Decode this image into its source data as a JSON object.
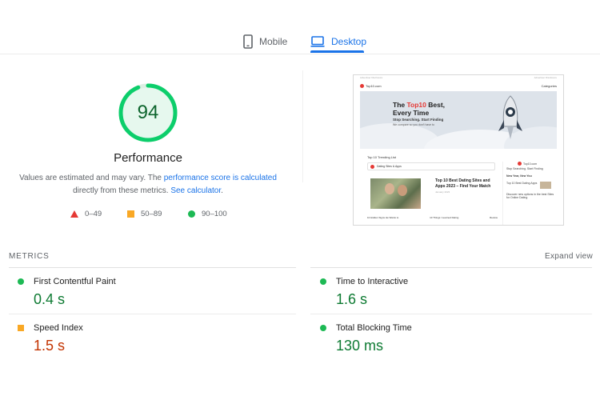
{
  "tabs": {
    "mobile_label": "Mobile",
    "desktop_label": "Desktop",
    "active": "desktop"
  },
  "score": {
    "value": "94",
    "fraction": 0.94,
    "title": "Performance",
    "desc_prefix": "Values are estimated and may vary. The ",
    "desc_link1": "performance score is calculated",
    "desc_middle": " directly from these metrics. ",
    "desc_link2": "See calculator",
    "desc_suffix": "."
  },
  "legend": {
    "fail": "0–49",
    "average": "50–89",
    "pass": "90–100"
  },
  "screenshot": {
    "top_left": "Advertiser Disclosure",
    "top_right": "Advertiser Disclosure",
    "logo": "Top10.com",
    "categories": "Categories",
    "hero_title_before": "The ",
    "hero_title_highlight": "Top10",
    "hero_title_after": " Best, Every Time",
    "hero_sub": "Stop Searching. Start Finding",
    "hero_sub2": "We compare so you don't have to",
    "trending": "Top 10 Trending List",
    "trending_select": "Dating Sites & Apps",
    "post_title": "Top 10 Best Dating Sites and Apps 2023 – Find Your Match",
    "post_meta": "January 2023",
    "bottom_left": "10 Hidden Signs He Wants to",
    "bottom_mid": "10 Things I Learned Dating",
    "bottom_right": "Review",
    "side_logo": "Top10.com",
    "side_tag": "Stop Searching. Start Finding",
    "side_h": "New Year, New You",
    "side_item": "Top 10 Best Dating Apps",
    "side_item2": "Discover new options in the best Sites for Online Dating"
  },
  "metrics": {
    "heading": "METRICS",
    "expand": "Expand view",
    "fcp_label": "First Contentful Paint",
    "fcp_value": "0.4 s",
    "tti_label": "Time to Interactive",
    "tti_value": "1.6 s",
    "si_label": "Speed Index",
    "si_value": "1.5 s",
    "tbt_label": "Total Blocking Time",
    "tbt_value": "130 ms"
  },
  "colors": {
    "accent": "#1a73e8",
    "pass": "#0cce6b",
    "average": "#ffa400",
    "fail": "#ff4e42"
  }
}
